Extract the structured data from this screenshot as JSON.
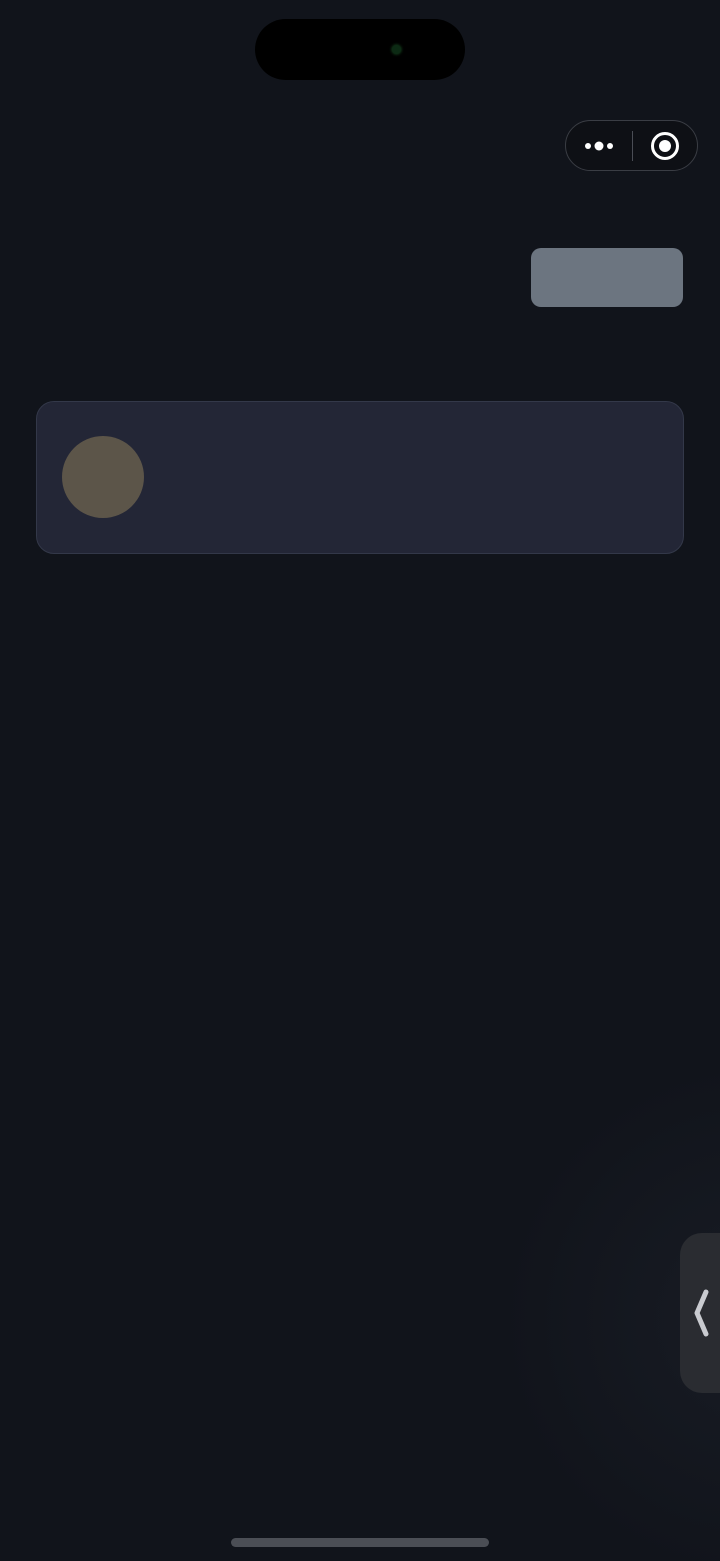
{
  "status_bar": {
    "dynamic_island": "dynamic-island",
    "camera_indicator_color": "#1f5e2a"
  },
  "capsule": {
    "more_icon": "more-dots-icon",
    "close_icon": "target-circle-icon",
    "background": "#0e1015"
  },
  "header": {
    "action_button_color": "#6c7580"
  },
  "card": {
    "background": "#232636",
    "avatar_color": "#5c5549"
  },
  "side_handle": {
    "icon": "chevron-left-icon",
    "background": "#2a2c31"
  },
  "theme": {
    "page_background": "#11141b"
  }
}
